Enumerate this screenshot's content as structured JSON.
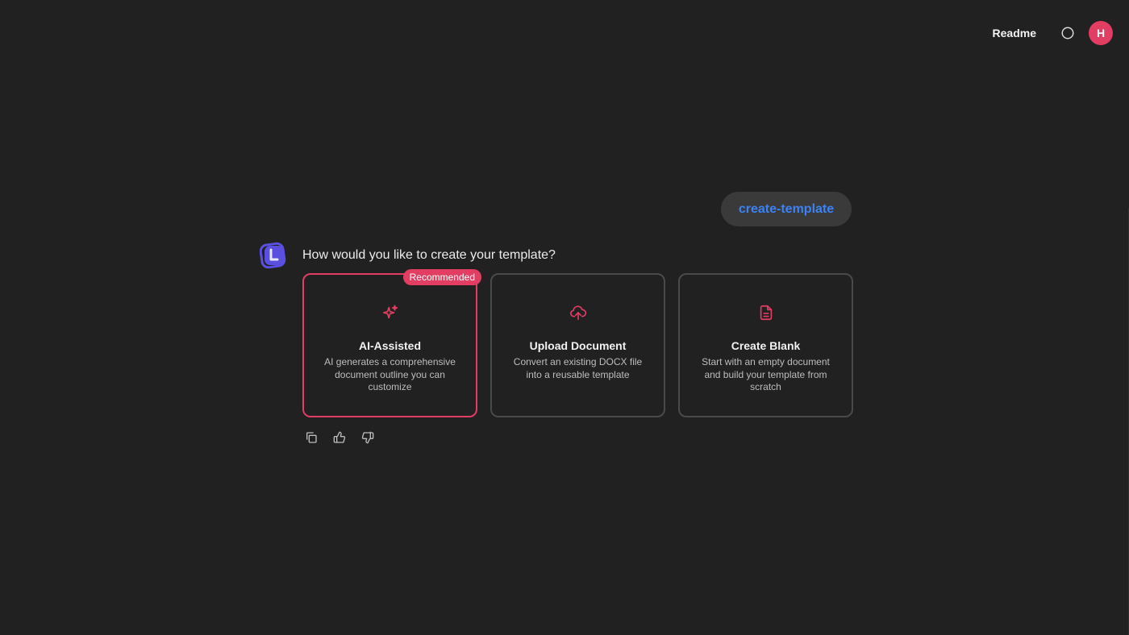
{
  "header": {
    "readme_label": "Readme",
    "avatar_initial": "H"
  },
  "chat": {
    "user_message": "create-template",
    "assistant_question": "How would you like to create your template?"
  },
  "options": [
    {
      "title": "AI-Assisted",
      "description": "AI generates a comprehensive document outline you can customize",
      "badge": "Recommended",
      "icon": "sparkles-icon",
      "selected": true
    },
    {
      "title": "Upload Document",
      "description": "Convert an existing DOCX file into a reusable template",
      "icon": "cloud-upload-icon",
      "selected": false
    },
    {
      "title": "Create Blank",
      "description": "Start with an empty document and build your template from scratch",
      "icon": "file-text-icon",
      "selected": false
    }
  ],
  "message_actions": [
    "copy-icon",
    "thumbs-up-icon",
    "thumbs-down-icon"
  ],
  "colors": {
    "accent": "#e23d63",
    "link_blue": "#3b82f6",
    "background": "#212121",
    "logo": "#5b4fe0"
  }
}
